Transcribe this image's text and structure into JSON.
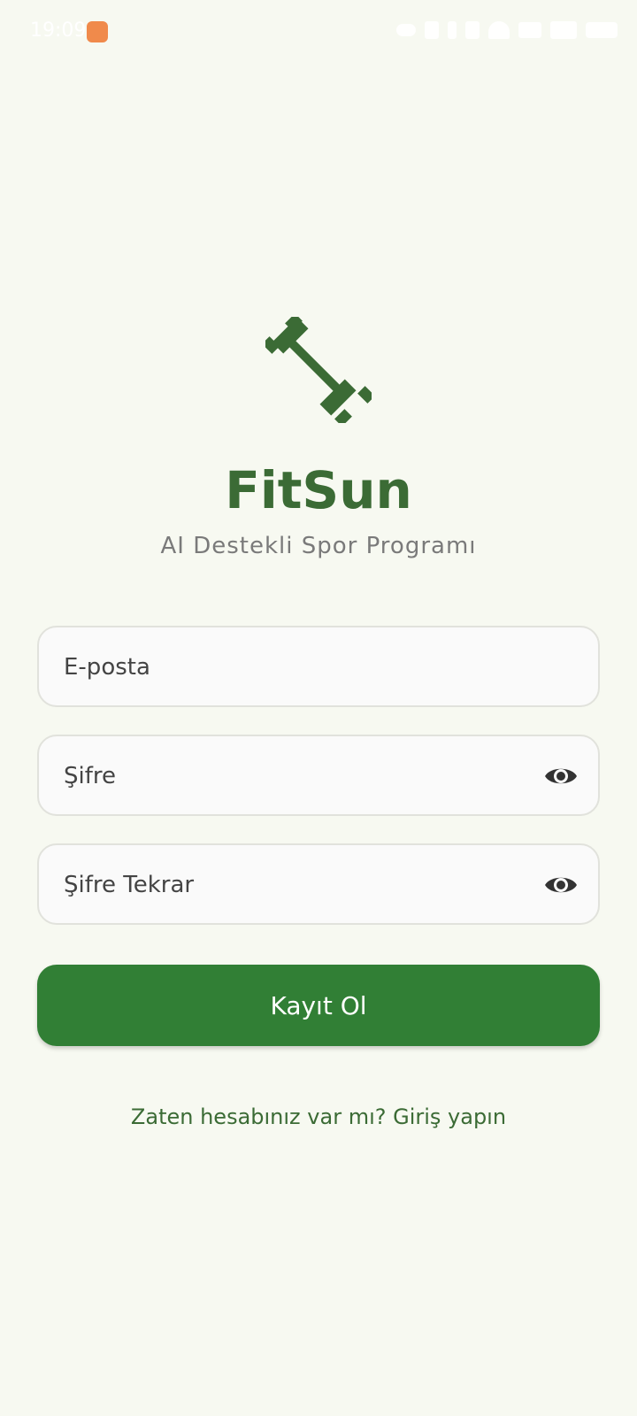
{
  "status_bar": {
    "time": "19:09",
    "icons": [
      "shield-app-icon",
      "eye-icon",
      "nfc-icon",
      "bluetooth-icon",
      "vibrate-icon",
      "wifi-icon",
      "volte-icon",
      "signal-icon",
      "battery-icon"
    ]
  },
  "branding": {
    "logo_icon": "dumbbell-icon",
    "title": "FitSun",
    "subtitle": "AI Destekli Spor Programı"
  },
  "form": {
    "email_placeholder": "E-posta",
    "password_placeholder": "Şifre",
    "password_confirm_placeholder": "Şifre Tekrar",
    "submit_label": "Kayıt Ol"
  },
  "footer": {
    "login_link": "Zaten hesabınız var mı? Giriş yapın"
  },
  "colors": {
    "background": "#f7f9f1",
    "brand_green": "#3b6b35",
    "button_green": "#317f35",
    "subtitle_gray": "#7a7a7a"
  }
}
